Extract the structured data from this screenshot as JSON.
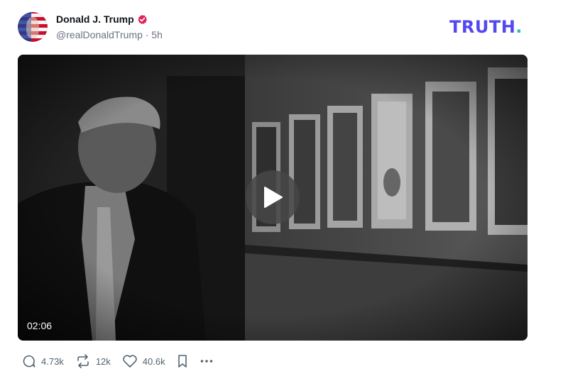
{
  "post": {
    "author": {
      "display_name": "Donald J. Trump",
      "handle": "@realDonaldTrump",
      "time_ago": "5h",
      "meta": "@realDonaldTrump · 5h",
      "verified_icon": "verified-badge-icon",
      "verified_color": "#e0245e"
    },
    "video": {
      "duration": "02:06",
      "play_icon": "play-icon"
    },
    "actions": {
      "replies": "4.73k",
      "retruths": "12k",
      "likes": "40.6k",
      "bookmark_icon": "bookmark-icon",
      "more_icon": "more-icon"
    }
  },
  "brand": {
    "logo_text": "TRUTH",
    "logo_dot": ".",
    "logo_color": "#5448ee",
    "dot_color": "#22c3a9"
  }
}
